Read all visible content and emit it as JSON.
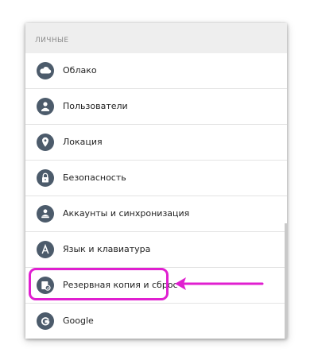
{
  "section": {
    "title": "ЛИЧНЫЕ"
  },
  "items": [
    {
      "label": "Облако",
      "icon": "cloud-icon"
    },
    {
      "label": "Пользователи",
      "icon": "user-icon"
    },
    {
      "label": "Локация",
      "icon": "location-pin-icon"
    },
    {
      "label": "Безопасность",
      "icon": "lock-icon"
    },
    {
      "label": "Аккаунты и синхронизация",
      "icon": "accounts-icon"
    },
    {
      "label": "Язык и клавиатура",
      "icon": "language-icon"
    },
    {
      "label": "Резервная копия и сброс",
      "icon": "backup-restore-icon"
    },
    {
      "label": "Google",
      "icon": "google-icon"
    }
  ],
  "colors": {
    "icon_background": "#4c5b6b",
    "highlight": "#e01fd0",
    "header_background": "#eeeeee"
  }
}
